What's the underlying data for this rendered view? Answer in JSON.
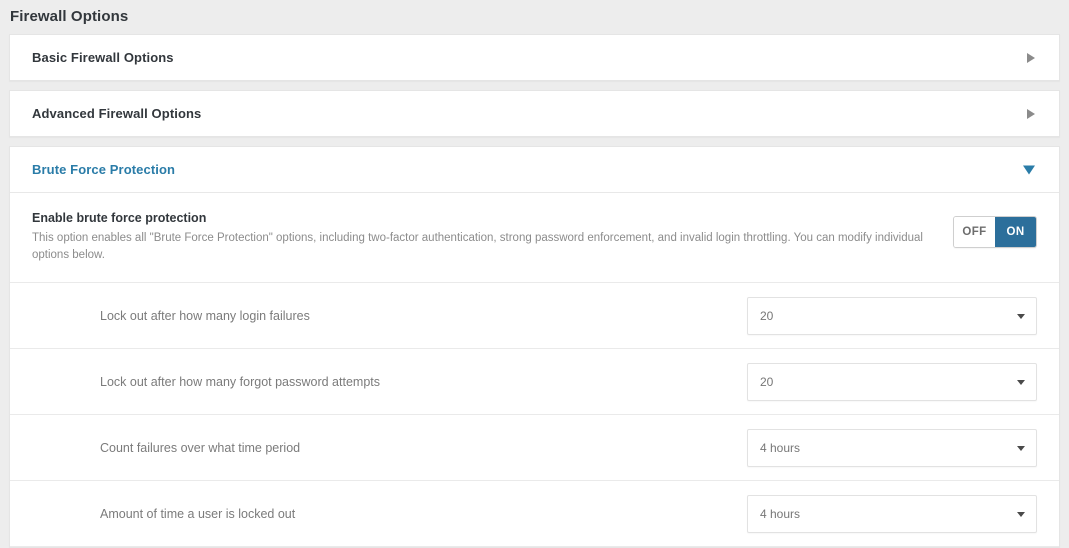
{
  "page": {
    "title": "Firewall Options"
  },
  "panels": [
    {
      "title": "Basic Firewall Options",
      "state": "collapsed",
      "icon": "caret-right-icon"
    },
    {
      "title": "Advanced Firewall Options",
      "state": "collapsed",
      "icon": "caret-right-icon"
    },
    {
      "title": "Brute Force Protection",
      "state": "expanded",
      "icon": "caret-down-icon"
    }
  ],
  "brute_force": {
    "master": {
      "label": "Enable brute force protection",
      "description": "This option enables all \"Brute Force Protection\" options, including two-factor authentication, strong password enforcement, and invalid login throttling. You can modify individual options below.",
      "toggle": {
        "off_label": "OFF",
        "on_label": "ON",
        "value": "ON"
      }
    },
    "options": [
      {
        "label": "Lock out after how many login failures",
        "value": "20"
      },
      {
        "label": "Lock out after how many forgot password attempts",
        "value": "20"
      },
      {
        "label": "Count failures over what time period",
        "value": "4 hours"
      },
      {
        "label": "Amount of time a user is locked out",
        "value": "4 hours"
      }
    ]
  },
  "colors": {
    "accent_blue": "#2a7ca8",
    "toggle_on_bg": "#2c6f9b",
    "page_bg": "#ededed",
    "panel_bg": "#ffffff",
    "border": "#e5e5e5",
    "label_text": "#7b7b7b",
    "heading_text": "#32373c"
  }
}
